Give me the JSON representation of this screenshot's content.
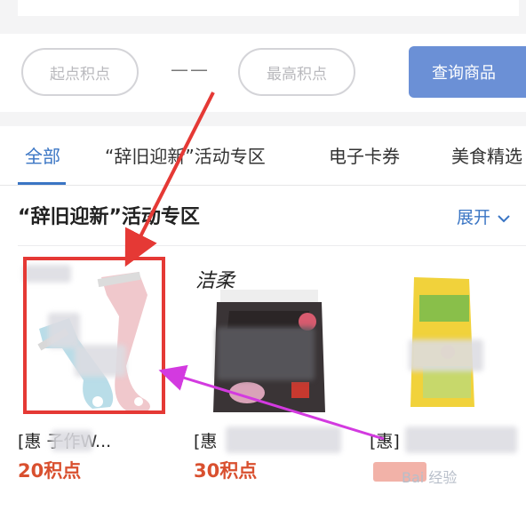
{
  "filter": {
    "min_placeholder": "起点积点",
    "separator": "——",
    "max_placeholder": "最高积点",
    "query_label": "查询商品"
  },
  "tabs": [
    {
      "label": "全部",
      "active": true
    },
    {
      "label": "“辞旧迎新”活动专区",
      "active": false
    },
    {
      "label": "电子卡券",
      "active": false
    },
    {
      "label": "美食精选",
      "active": false
    }
  ],
  "section": {
    "title": "“辞旧迎新”活动专区",
    "expand_label": "展开",
    "expand_icon": "chevron-down-icon"
  },
  "products": [
    {
      "name": "[惠   子作W...",
      "points": "20积点",
      "image": "peeler-image"
    },
    {
      "name": "[惠",
      "points": "30积点",
      "image": "tissue-pack-image"
    },
    {
      "name": "[惠]",
      "points": "",
      "image": "rice-bag-image"
    }
  ],
  "brand_mark": "洁柔",
  "watermark": "Bai 经验",
  "colors": {
    "accent": "#3a75c4",
    "button": "#6b90d6",
    "points": "#d9502f",
    "highlight_box": "#e53935",
    "annotation_arrow_magenta": "#d33ae0"
  }
}
